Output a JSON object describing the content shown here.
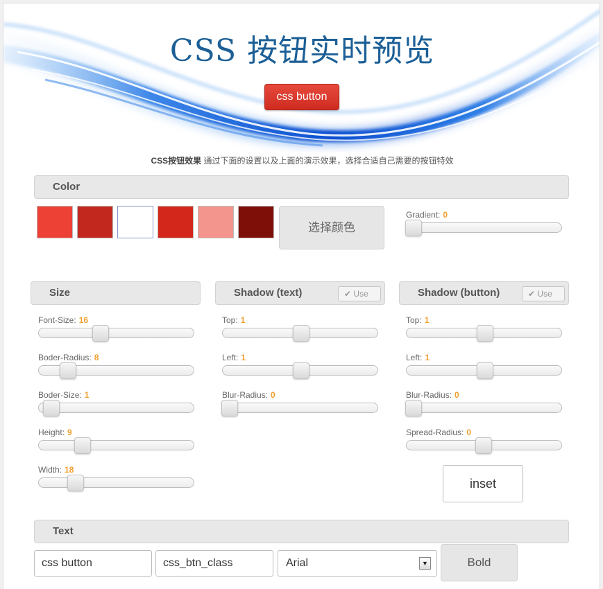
{
  "header": {
    "title": "CSS 按钮实时预览",
    "demo_button_label": "css button"
  },
  "intro": {
    "bold": "CSS按钮效果",
    "text": " 通过下面的设置以及上面的演示效果，选择合适自己需要的按钮特效"
  },
  "color": {
    "section_title": "Color",
    "swatches": [
      "#ee4136",
      "#c2281e",
      "#ffffff",
      "#d2271a",
      "#f3958d",
      "#7d0f08"
    ],
    "pick_button_label": "选择颜色",
    "gradient_label": "Gradient:",
    "gradient_value": "0"
  },
  "size": {
    "section_title": "Size",
    "sliders": [
      {
        "label": "Font-Size:",
        "value": "16"
      },
      {
        "label": "Boder-Radius:",
        "value": "8"
      },
      {
        "label": "Boder-Size:",
        "value": "1"
      },
      {
        "label": "Height:",
        "value": "9"
      },
      {
        "label": "Width:",
        "value": "18"
      }
    ]
  },
  "shadow_text": {
    "section_title": "Shadow (text)",
    "use_label": "Use",
    "sliders": [
      {
        "label": "Top:",
        "value": "1"
      },
      {
        "label": "Left:",
        "value": "1"
      },
      {
        "label": "Blur-Radius:",
        "value": "0"
      }
    ]
  },
  "shadow_button": {
    "section_title": "Shadow (button)",
    "use_label": "Use",
    "sliders": [
      {
        "label": "Top:",
        "value": "1"
      },
      {
        "label": "Left:",
        "value": "1"
      },
      {
        "label": "Blur-Radius:",
        "value": "0"
      },
      {
        "label": "Spread-Radius:",
        "value": "0"
      }
    ],
    "inset_label": "inset"
  },
  "text": {
    "section_title": "Text",
    "button_text_value": "css button",
    "class_name_value": "css_btn_class",
    "font_selected": "Arial",
    "bold_label": "Bold"
  },
  "icons": {
    "check": "✔",
    "dropdown": "▼"
  },
  "colors": {
    "accent_value": "#f0a030",
    "title_blue": "#1c5f96",
    "demo_button_red": "#d8352a"
  }
}
